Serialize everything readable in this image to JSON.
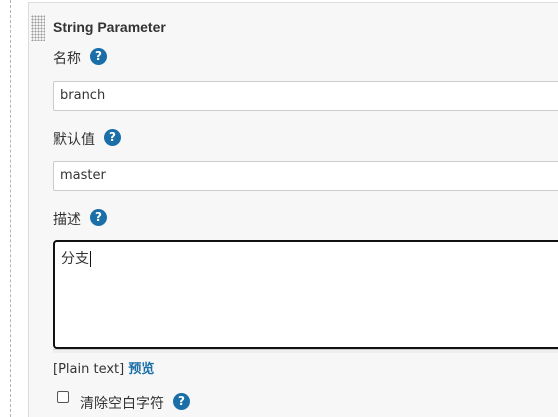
{
  "section": {
    "title": "String Parameter"
  },
  "help_glyph": "?",
  "fields": {
    "name": {
      "label": "名称",
      "value": "branch"
    },
    "default_value": {
      "label": "默认值",
      "value": "master"
    },
    "description": {
      "label": "描述",
      "value": "分支"
    }
  },
  "format": {
    "plain_text": "[Plain text]",
    "preview_link": "预览"
  },
  "trim_option": {
    "label": "清除空白字符",
    "checked": false
  },
  "colors": {
    "accent": "#1a6fa8",
    "panel_bg": "#f7f7f7"
  },
  "icons": {
    "help": "question-circle-icon",
    "drag": "drag-handle-dots"
  }
}
